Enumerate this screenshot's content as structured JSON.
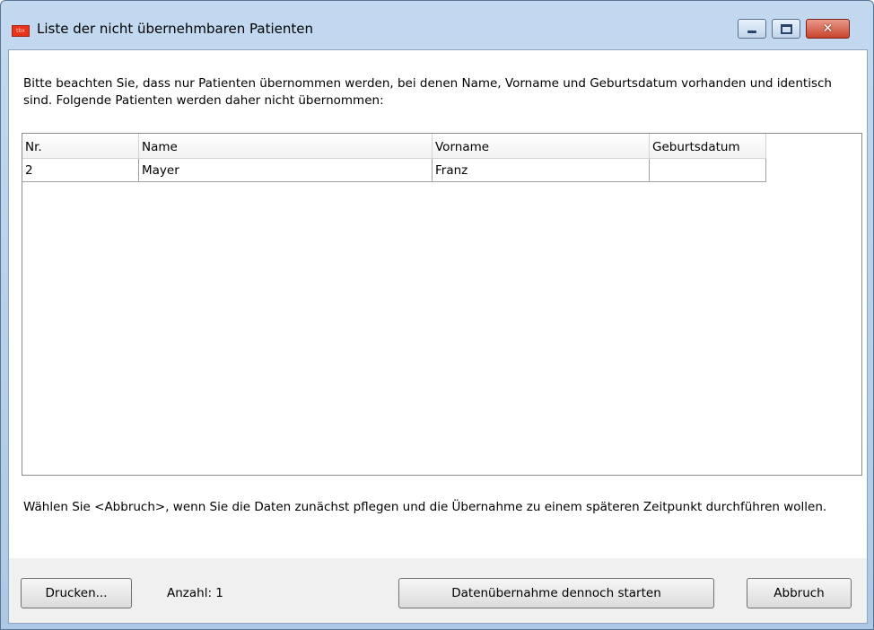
{
  "window": {
    "title": "Liste der nicht übernehmbaren Patienten",
    "icon": "app-icon"
  },
  "intro_text": "Bitte beachten Sie, dass nur Patienten übernommen werden, bei denen Name, Vorname und Geburtsdatum vorhanden und identisch sind. Folgende Patienten werden daher nicht übernommen:",
  "table": {
    "columns": [
      "Nr.",
      "Name",
      "Vorname",
      "Geburtsdatum"
    ],
    "rows": [
      [
        "2",
        "Mayer",
        "Franz",
        ""
      ]
    ]
  },
  "footer_text": "Wählen Sie <Abbruch>, wenn Sie die Daten zunächst pflegen und die Übernahme zu einem späteren Zeitpunkt durchführen wollen.",
  "buttons": {
    "print": "Drucken...",
    "start": "Datenübernahme dennoch starten",
    "cancel": "Abbruch"
  },
  "count_label": "Anzahl: 1"
}
